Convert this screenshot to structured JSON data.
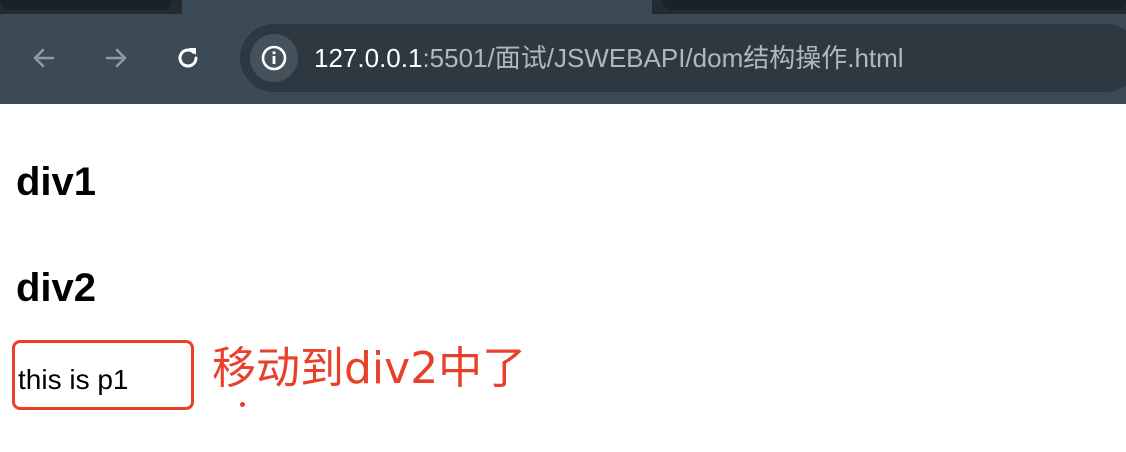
{
  "browser": {
    "url_host": "127.0.0.1",
    "url_rest": ":5501/面试/JSWEBAPI/dom结构操作.html"
  },
  "page": {
    "heading_div1": "div1",
    "heading_div2": "div2",
    "paragraph_p1": "this is p1"
  },
  "annotation": {
    "text": "移动到div2中了",
    "color": "#e8402a"
  },
  "icons": {
    "back": "arrow-left-icon",
    "forward": "arrow-right-icon",
    "reload": "reload-icon",
    "site_info": "info-icon"
  }
}
